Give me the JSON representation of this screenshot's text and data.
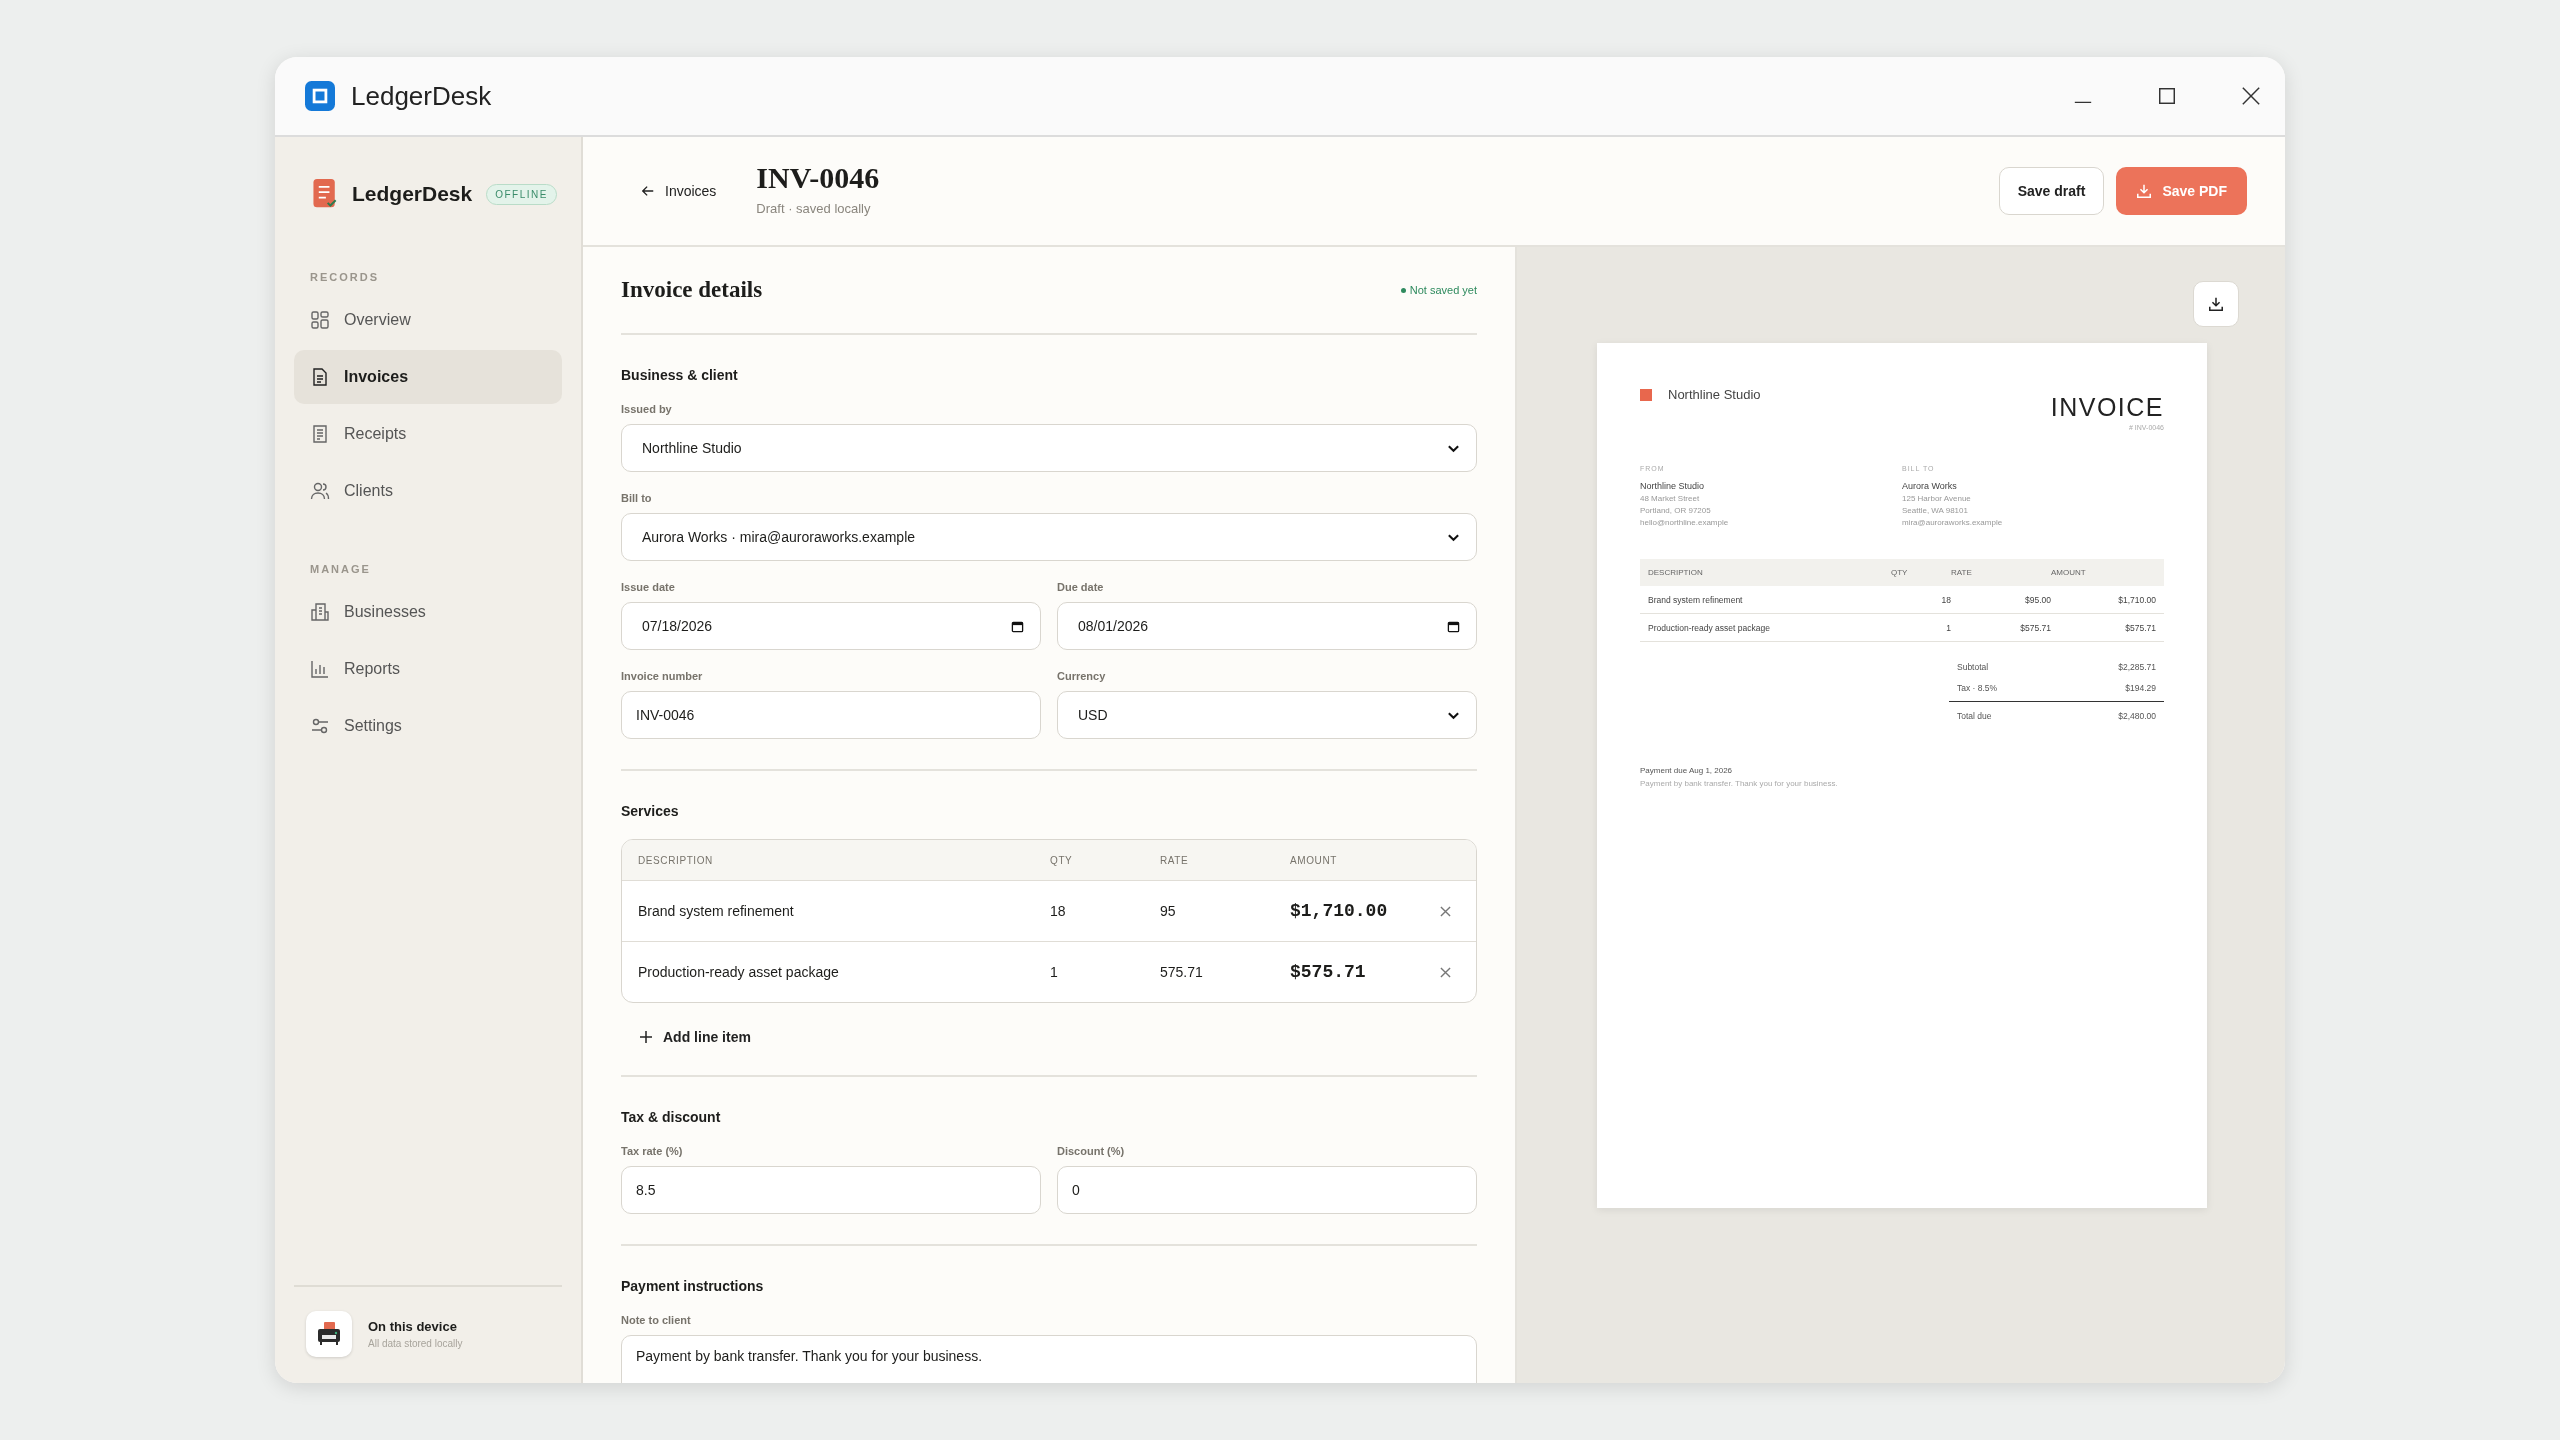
{
  "window": {
    "title": "LedgerDesk"
  },
  "sidebar": {
    "brand": "LedgerDesk",
    "badge": "OFFLINE",
    "groups": [
      {
        "heading": "RECORDS",
        "items": [
          {
            "label": "Overview",
            "selected": false
          },
          {
            "label": "Invoices",
            "selected": true
          },
          {
            "label": "Receipts",
            "selected": false
          },
          {
            "label": "Clients",
            "selected": false
          }
        ]
      },
      {
        "heading": "MANAGE",
        "items": [
          {
            "label": "Businesses",
            "selected": false
          },
          {
            "label": "Reports",
            "selected": false
          },
          {
            "label": "Settings",
            "selected": false
          }
        ]
      }
    ],
    "footer": {
      "title": "On this device",
      "subtitle": "All data stored locally"
    }
  },
  "header": {
    "back": "Invoices",
    "title": "INV-0046",
    "subtitle": "Draft · saved locally",
    "buttons": [
      {
        "label": "Save draft",
        "kind": "secondary"
      },
      {
        "label": "Save PDF",
        "kind": "primary"
      }
    ]
  },
  "form": {
    "title": "Invoice details",
    "status": "Not saved yet",
    "business": {
      "title": "Business & client",
      "rows": [
        [
          {
            "label": "Issued by",
            "value": "Northline Studio",
            "kind": "select"
          }
        ],
        [
          {
            "label": "Bill to",
            "value": "Aurora Works · mira@auroraworks.example",
            "kind": "select"
          }
        ],
        [
          {
            "label": "Issue date",
            "value": "07/18/2026",
            "kind": "date"
          },
          {
            "label": "Due date",
            "value": "08/01/2026",
            "kind": "date"
          }
        ],
        [
          {
            "label": "Invoice number",
            "value": "INV-0046",
            "kind": "text"
          },
          {
            "label": "Currency",
            "value": "USD",
            "kind": "select"
          }
        ]
      ]
    },
    "services": {
      "title": "Services",
      "columns": [
        "DESCRIPTION",
        "QTY",
        "RATE",
        "AMOUNT"
      ],
      "rows": [
        {
          "description": "Brand system refinement",
          "qty": "18",
          "rate": "95",
          "amount": "$1,710.00"
        },
        {
          "description": "Production-ready asset package",
          "qty": "1",
          "rate": "575.71",
          "amount": "$575.71"
        }
      ],
      "add": "Add line item"
    },
    "tax": {
      "title": "Tax & discount",
      "rows": [
        [
          {
            "label": "Tax rate (%)",
            "value": "8.5",
            "kind": "text"
          },
          {
            "label": "Discount (%)",
            "value": "0",
            "kind": "text"
          }
        ]
      ]
    },
    "payment": {
      "title": "Payment instructions",
      "note_label": "Note to client",
      "note": "Payment by bank transfer. Thank you for your business."
    }
  },
  "preview": {
    "business": "Northline Studio",
    "title": "INVOICE",
    "number": "# INV-0046",
    "parties": [
      {
        "label": "FROM",
        "name": "Northline Studio",
        "lines": [
          "48 Market Street",
          "Portland, OR 97205",
          "hello@northline.example"
        ]
      },
      {
        "label": "BILL TO",
        "name": "Aurora Works",
        "lines": [
          "125 Harbor Avenue",
          "Seattle, WA 98101",
          "mira@auroraworks.example"
        ]
      }
    ],
    "columns": [
      "DESCRIPTION",
      "QTY",
      "RATE",
      "AMOUNT"
    ],
    "rows": [
      {
        "description": "Brand system refinement",
        "qty": "18",
        "rate": "$95.00",
        "amount": "$1,710.00"
      },
      {
        "description": "Production-ready asset package",
        "qty": "1",
        "rate": "$575.71",
        "amount": "$575.71"
      }
    ],
    "totals": [
      {
        "label": "Subtotal",
        "value": "$2,285.71",
        "kind": "line"
      },
      {
        "label": "Tax  ·  8.5%",
        "value": "$194.29",
        "kind": "line"
      },
      {
        "label": "Total due",
        "value": "$2,480.00",
        "kind": "total"
      }
    ],
    "due": "Payment due Aug 1, 2026",
    "note": "Payment by bank transfer. Thank you for your business."
  }
}
